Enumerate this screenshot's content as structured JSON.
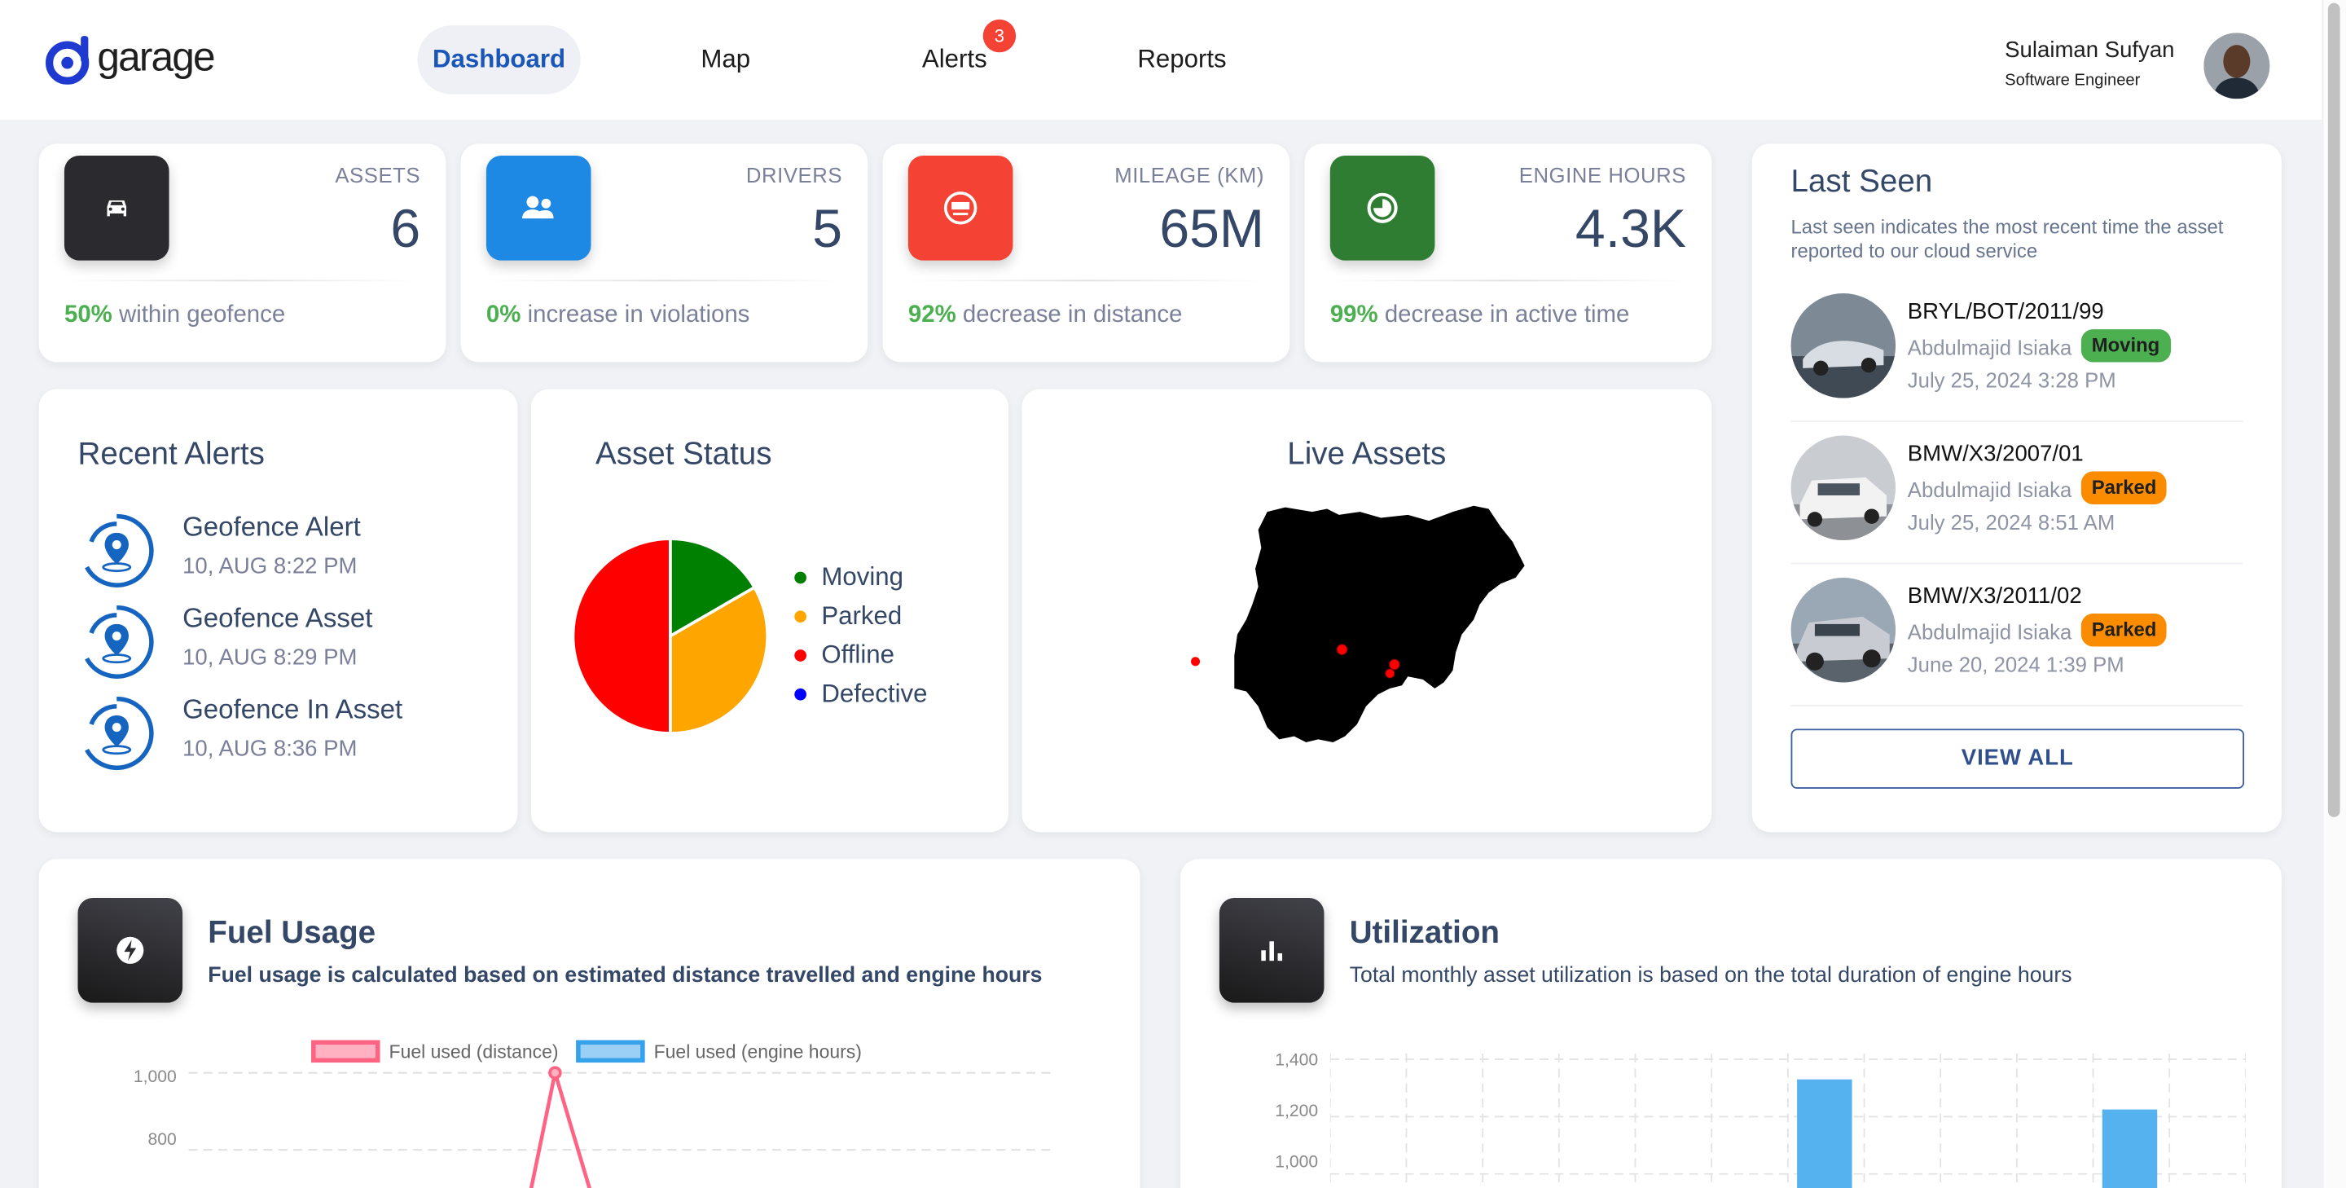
{
  "brand": {
    "logo_text": "garage"
  },
  "nav": {
    "items": [
      {
        "label": "Dashboard",
        "active": true
      },
      {
        "label": "Map",
        "active": false
      },
      {
        "label": "Alerts",
        "active": false,
        "badge": "3"
      },
      {
        "label": "Reports",
        "active": false
      }
    ]
  },
  "user": {
    "name": "Sulaiman Sufyan",
    "role": "Software Engineer"
  },
  "stats": [
    {
      "label": "ASSETS",
      "value": "6",
      "pct": "50%",
      "foot": " within geofence",
      "icon": "car-icon",
      "color": "#2b2b2f"
    },
    {
      "label": "DRIVERS",
      "value": "5",
      "pct": "0%",
      "foot": " increase in violations",
      "icon": "users-icon",
      "color": "#1e88e5"
    },
    {
      "label": "MILEAGE (KM)",
      "value": "65M",
      "pct": "92%",
      "foot": " decrease in distance",
      "icon": "odometer-icon",
      "color": "#f44335"
    },
    {
      "label": "ENGINE HOURS",
      "value": "4.3K",
      "pct": "99%",
      "foot": " decrease in active time",
      "icon": "timer-icon",
      "color": "#2e7d32"
    }
  ],
  "recent_alerts": {
    "title": "Recent Alerts",
    "items": [
      {
        "title": "Geofence Alert",
        "time": "10, AUG 8:22 PM"
      },
      {
        "title": "Geofence Asset",
        "time": "10, AUG 8:29 PM"
      },
      {
        "title": "Geofence In Asset",
        "time": "10, AUG 8:36 PM"
      }
    ]
  },
  "asset_status": {
    "title": "Asset Status",
    "legend": [
      {
        "label": "Moving",
        "color": "#008000"
      },
      {
        "label": "Parked",
        "color": "#ffa500"
      },
      {
        "label": "Offline",
        "color": "#ff0000"
      },
      {
        "label": "Defective",
        "color": "#0000ff"
      }
    ]
  },
  "live_assets": {
    "title": "Live Assets"
  },
  "last_seen": {
    "title": "Last Seen",
    "description": "Last seen indicates the most recent time the asset reported to our cloud service",
    "items": [
      {
        "plate": "BRYL/BOT/2011/99",
        "driver": "Abdulmajid Isiaka",
        "status": "Moving",
        "status_color": "#4caf50",
        "date": "July 25, 2024 3:28 PM"
      },
      {
        "plate": "BMW/X3/2007/01",
        "driver": "Abdulmajid Isiaka",
        "status": "Parked",
        "status_color": "#fb8c00",
        "date": "July 25, 2024 8:51 AM"
      },
      {
        "plate": "BMW/X3/2011/02",
        "driver": "Abdulmajid Isiaka",
        "status": "Parked",
        "status_color": "#fb8c00",
        "date": "June 20, 2024 1:39 PM"
      }
    ],
    "view_all": "VIEW ALL"
  },
  "fuel_usage": {
    "title": "Fuel Usage",
    "subtitle": "Fuel usage is calculated based on estimated distance travelled and engine hours",
    "legend": [
      "Fuel used (distance)",
      "Fuel used (engine hours)"
    ],
    "y_ticks": [
      "1,000",
      "800"
    ]
  },
  "utilization": {
    "title": "Utilization",
    "subtitle": "Total monthly asset utilization is based on the total duration of engine hours",
    "y_ticks": [
      "1,400",
      "1,200",
      "1,000"
    ]
  },
  "chart_data": [
    {
      "type": "pie",
      "title": "Asset Status",
      "categories": [
        "Moving",
        "Parked",
        "Offline",
        "Defective"
      ],
      "values": [
        1,
        2,
        3,
        0
      ],
      "colors": [
        "#008000",
        "#ffa500",
        "#ff0000",
        "#0000ff"
      ]
    },
    {
      "type": "line",
      "title": "Fuel Usage",
      "series": [
        {
          "name": "Fuel used (distance)",
          "values": [
            null,
            1000,
            null
          ]
        },
        {
          "name": "Fuel used (engine hours)",
          "values": []
        }
      ],
      "ylim": [
        700,
        1050
      ],
      "y_ticks": [
        800,
        1000
      ]
    },
    {
      "type": "bar",
      "title": "Utilization",
      "values": [
        1330,
        1225
      ],
      "ylim": [
        950,
        1420
      ],
      "y_ticks": [
        1000,
        1200,
        1400
      ]
    }
  ]
}
